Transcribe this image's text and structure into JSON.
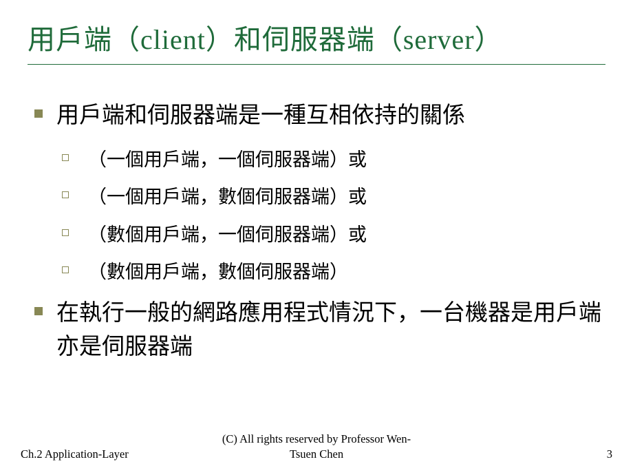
{
  "slide": {
    "title": "用戶端（client）和伺服器端（server）",
    "bullets": [
      {
        "level": 1,
        "text": "用戶端和伺服器端是一種互相依持的關係"
      },
      {
        "level": 2,
        "text": "（一個用戶端，一個伺服器端）或"
      },
      {
        "level": 2,
        "text": "（一個用戶端，數個伺服器端）或"
      },
      {
        "level": 2,
        "text": "（數個用戶端，一個伺服器端）或"
      },
      {
        "level": 2,
        "text": "（數個用戶端，數個伺服器端）"
      },
      {
        "level": 1,
        "text": "在執行一般的網路應用程式情況下，一台機器是用戶端亦是伺服器端"
      }
    ]
  },
  "footer": {
    "left": "Ch.2 Application-Layer",
    "center": "(C) All rights reserved by Professor Wen-Tsuen Chen",
    "right": "3"
  }
}
